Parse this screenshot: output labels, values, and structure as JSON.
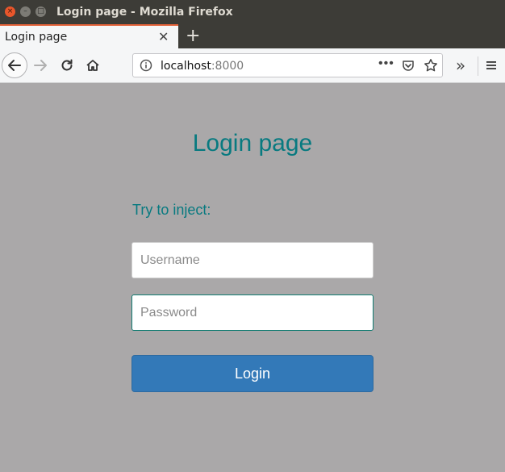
{
  "window": {
    "title": "Login page - Mozilla Firefox",
    "close_glyph": "×",
    "minimize_glyph": "–",
    "maximize_glyph": "□"
  },
  "tabs": [
    {
      "label": "Login page",
      "close_glyph": "✕"
    }
  ],
  "newtab_glyph": "+",
  "navbar": {
    "url_host": "localhost",
    "url_port": ":8000",
    "more_glyph": "•••",
    "overflow_glyph": "»",
    "icons": [
      "back-arrow-icon",
      "forward-arrow-icon",
      "reload-icon",
      "home-icon",
      "info-icon",
      "page-actions-icon",
      "pocket-icon",
      "bookmark-star-icon",
      "overflow-chevron-icon",
      "hamburger-menu-icon"
    ]
  },
  "page": {
    "title": "Login page",
    "inject_label": "Try to inject:",
    "username_placeholder": "Username",
    "password_placeholder": "Password",
    "login_label": "Login"
  },
  "colors": {
    "page_bg": "#aaa8a9",
    "accent_teal": "#087a80",
    "button_blue": "#3379b8",
    "titlebar": "#3d3c37",
    "tab_highlight": "#e36138"
  }
}
